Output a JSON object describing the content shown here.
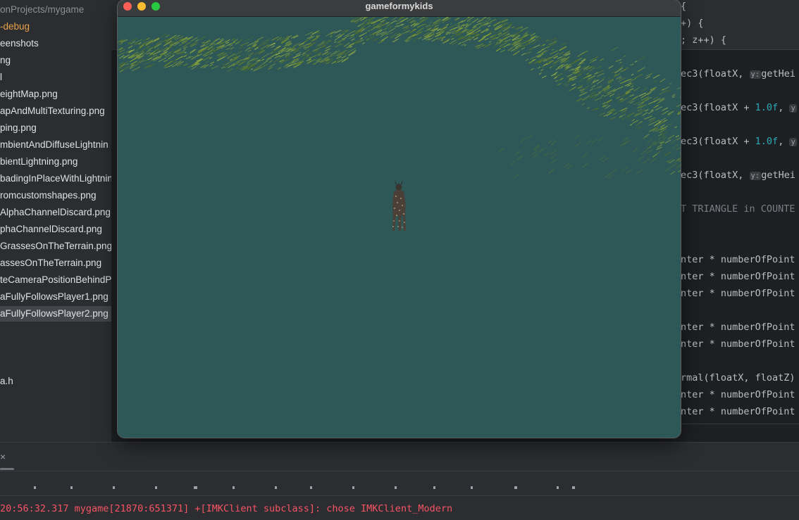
{
  "sidebar": {
    "items": [
      {
        "label": "onProjects/mygame",
        "style": "dim"
      },
      {
        "label": "-debug",
        "style": "orange"
      },
      {
        "label": "eenshots",
        "style": ""
      },
      {
        "label": "ng",
        "style": ""
      },
      {
        "label": "l",
        "style": ""
      },
      {
        "label": "eightMap.png",
        "style": ""
      },
      {
        "label": "apAndMultiTexturing.png",
        "style": ""
      },
      {
        "label": "ping.png",
        "style": ""
      },
      {
        "label": "mbientAndDiffuseLightnin",
        "style": ""
      },
      {
        "label": "bientLightning.png",
        "style": ""
      },
      {
        "label": "badingInPlaceWithLightnin",
        "style": ""
      },
      {
        "label": "romcustomshapes.png",
        "style": ""
      },
      {
        "label": "AlphaChannelDiscard.png",
        "style": ""
      },
      {
        "label": "phaChannelDiscard.png",
        "style": ""
      },
      {
        "label": "GrassesOnTheTerrain.png",
        "style": ""
      },
      {
        "label": "assesOnTheTerrain.png",
        "style": ""
      },
      {
        "label": "teCameraPositionBehindP",
        "style": ""
      },
      {
        "label": "aFullyFollowsPlayer1.png",
        "style": ""
      },
      {
        "label": "aFullyFollowsPlayer2.png",
        "style": "selected"
      },
      {
        "label": "",
        "style": ""
      },
      {
        "label": "",
        "style": ""
      },
      {
        "label": "",
        "style": ""
      },
      {
        "label": "a.h",
        "style": ""
      }
    ]
  },
  "editor": {
    "lines": [
      {
        "row": 0,
        "text": "{"
      },
      {
        "row": 1,
        "text": "+) {"
      },
      {
        "row": 2,
        "text": "; z++) {"
      },
      {
        "row": 4,
        "parts": [
          {
            "t": "ec3(floatX, "
          },
          {
            "t": "y:",
            "c": "hint"
          },
          {
            "t": "getHei"
          }
        ]
      },
      {
        "row": 6,
        "parts": [
          {
            "t": "ec3(floatX + "
          },
          {
            "t": "1.0f",
            "c": "num"
          },
          {
            "t": ", "
          },
          {
            "t": "y",
            "c": "hint"
          }
        ]
      },
      {
        "row": 8,
        "parts": [
          {
            "t": "ec3(floatX + "
          },
          {
            "t": "1.0f",
            "c": "num"
          },
          {
            "t": ", "
          },
          {
            "t": "y",
            "c": "hint"
          }
        ]
      },
      {
        "row": 10,
        "parts": [
          {
            "t": "ec3(floatX, "
          },
          {
            "t": "y:",
            "c": "hint"
          },
          {
            "t": "getHei"
          }
        ]
      },
      {
        "row": 12,
        "parts": [
          {
            "t": "T TRIANGLE in COUNTE",
            "c": "cmt"
          }
        ]
      },
      {
        "row": 15,
        "text": "nter * numberOfPoint"
      },
      {
        "row": 16,
        "text": "nter * numberOfPoint"
      },
      {
        "row": 17,
        "text": "nter * numberOfPoint"
      },
      {
        "row": 19,
        "text": "nter * numberOfPoint"
      },
      {
        "row": 20,
        "text": "nter * numberOfPoint"
      },
      {
        "row": 22,
        "text": "rmal(floatX, floatZ)"
      },
      {
        "row": 23,
        "text": "nter * numberOfPoint"
      },
      {
        "row": 24,
        "text": "nter * numberOfPoint"
      }
    ]
  },
  "game_window": {
    "title": "gameformykids",
    "background_color": "#2e5858"
  },
  "bottom_panel": {
    "close_icon": "×",
    "console_line": "20:56:32.317 mygame[21870:651371] +[IMKClient subclass]: chose IMKClient_Modern"
  },
  "colors": {
    "ide_bg": "#2b2d30",
    "editor_bg": "#1e1f22",
    "console_error": "#f75464",
    "folder_orange": "#e8a24a",
    "grass": "#7e9a3a"
  },
  "icons": [
    "close-icon",
    "window-close-button",
    "window-minimize-button",
    "window-zoom-button"
  ]
}
